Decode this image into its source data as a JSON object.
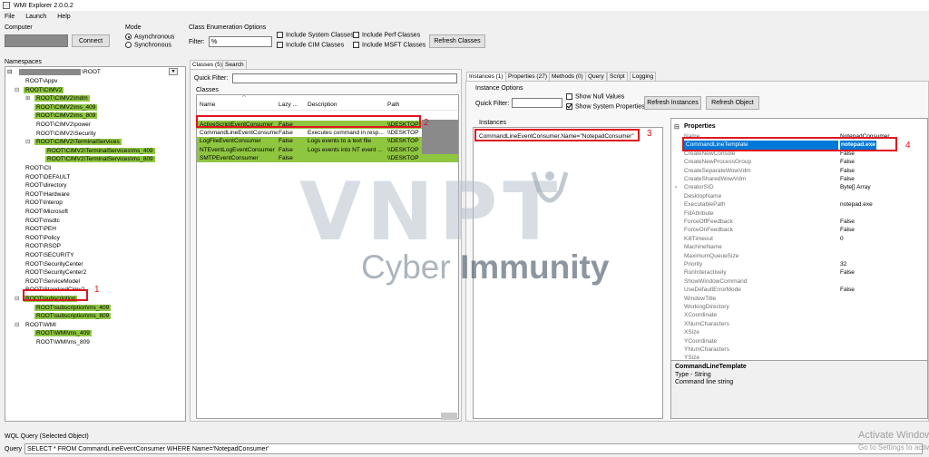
{
  "window": {
    "title": "WMI Explorer 2.0.0.2"
  },
  "menu": [
    "File",
    "Launch",
    "Help"
  ],
  "computer": {
    "label": "Computer",
    "connect_label": "Connect"
  },
  "mode": {
    "label": "Mode",
    "options": [
      "Asynchronous",
      "Synchronous"
    ],
    "selected": "Asynchronous"
  },
  "class_enum": {
    "label": "Class Enumeration Options",
    "filter_label": "Filter:",
    "filter_value": "%",
    "checkboxes": [
      "Include System Classes",
      "Include CIM Classes",
      "Include Perf Classes",
      "Include MSFT Classes"
    ],
    "refresh_label": "Refresh Classes"
  },
  "namespaces": {
    "label": "Namespaces",
    "root_suffix": "\\ROOT",
    "items": [
      "ROOT\\Appv",
      "ROOT\\CIMV2",
      "ROOT\\CIMV2\\mdm",
      "ROOT\\CIMV2\\ms_409",
      "ROOT\\CIMV2\\ms_809",
      "ROOT\\CIMV2\\power",
      "ROOT\\CIMV2\\Security",
      "ROOT\\CIMV2\\TerminalServices",
      "ROOT\\CIMV2\\TerminalServices\\ms_409",
      "ROOT\\CIMV2\\TerminalServices\\ms_809",
      "ROOT\\Cli",
      "ROOT\\DEFAULT",
      "ROOT\\directory",
      "ROOT\\Hardware",
      "ROOT\\Interop",
      "ROOT\\Microsoft",
      "ROOT\\msdtc",
      "ROOT\\PEH",
      "ROOT\\Policy",
      "ROOT\\RSOP",
      "ROOT\\SECURITY",
      "ROOT\\SecurityCenter",
      "ROOT\\SecurityCenter2",
      "ROOT\\ServiceModel",
      "ROOT\\StandardCimv2",
      "ROOT\\subscription",
      "ROOT\\subscription\\ms_409",
      "ROOT\\subscription\\ms_809",
      "ROOT\\WMI",
      "ROOT\\WMI\\ms_409",
      "ROOT\\WMI\\ms_809"
    ]
  },
  "classes": {
    "tabs": [
      "Classes (5)",
      "Search"
    ],
    "quick_filter_label": "Quick Filter:",
    "group_label": "Classes",
    "columns": [
      "Name",
      "Lazy ...",
      "Description",
      "Path"
    ],
    "rows": [
      [
        "ActiveScriptEventConsumer",
        "False",
        "",
        "\\\\DESKTOP"
      ],
      [
        "CommandLineEventConsumer",
        "False",
        "Executes command in resp...",
        "\\\\DESKTOP"
      ],
      [
        "LogFileEventConsumer",
        "False",
        "Logs events to a text file",
        "\\\\DESKTOP"
      ],
      [
        "NTEventLogEventConsumer",
        "False",
        "Logs events into NT event ...",
        "\\\\DESKTOP"
      ],
      [
        "SMTPEventConsumer",
        "False",
        "",
        "\\\\DESKTOP"
      ]
    ]
  },
  "instances": {
    "tabs": [
      "Instances (1)",
      "Properties (27)",
      "Methods (0)",
      "Query",
      "Script",
      "Logging"
    ],
    "options_label": "Instance Options",
    "quick_filter_label": "Quick Filter:",
    "show_null": "Show Null Values",
    "show_system": "Show System Properties",
    "refresh_instances": "Refresh Instances",
    "refresh_object": "Refresh Object",
    "group_label": "Instances",
    "item": "CommandLineEventConsumer.Name=\"NotepadConsumer\""
  },
  "properties": {
    "header": "Properties",
    "rows": [
      [
        "Name",
        "NotepadConsumer"
      ],
      [
        "CommandLineTemplate",
        "notepad.exe"
      ],
      [
        "CreateNewConsole",
        "False"
      ],
      [
        "CreateNewProcessGroup",
        "False"
      ],
      [
        "CreateSeparateWowVdm",
        "False"
      ],
      [
        "CreateSharedWowVdm",
        "False"
      ],
      [
        "CreatorSID",
        "Byte[] Array"
      ],
      [
        "DesktopName",
        ""
      ],
      [
        "ExecutablePath",
        "notepad.exe"
      ],
      [
        "FillAttribute",
        ""
      ],
      [
        "ForceOffFeedback",
        "False"
      ],
      [
        "ForceOnFeedback",
        "False"
      ],
      [
        "KillTimeout",
        "0"
      ],
      [
        "MachineName",
        ""
      ],
      [
        "MaximumQueueSize",
        ""
      ],
      [
        "Priority",
        "32"
      ],
      [
        "RunInteractively",
        "False"
      ],
      [
        "ShowWindowCommand",
        ""
      ],
      [
        "UseDefaultErrorMode",
        "False"
      ],
      [
        "WindowTitle",
        ""
      ],
      [
        "WorkingDirectory",
        ""
      ],
      [
        "XCoordinate",
        ""
      ],
      [
        "XNumCharacters",
        ""
      ],
      [
        "XSize",
        ""
      ],
      [
        "YCoordinate",
        ""
      ],
      [
        "YNumCharacters",
        ""
      ],
      [
        "YSize",
        ""
      ]
    ],
    "desc_title": "CommandLineTemplate",
    "desc_type": "Type - String",
    "desc_text": "Command line string"
  },
  "annotations": [
    "1",
    "2",
    "3",
    "4"
  ],
  "watermark": {
    "line1": "VNPT",
    "line2a": "Cyber ",
    "line2b": "Immunity"
  },
  "activation": {
    "line1": "Activate Windows",
    "line2": "Go to Settings to activate Windows."
  },
  "wql": {
    "label": "WQL Query (Selected Object)",
    "query_label": "Query",
    "query": "SELECT * FROM CommandLineEventConsumer WHERE Name='NotepadConsumer'"
  },
  "colors": {
    "highlight_green": "#8fc640",
    "annotation_red": "#e0141e",
    "selection_blue": "#0078d7"
  }
}
